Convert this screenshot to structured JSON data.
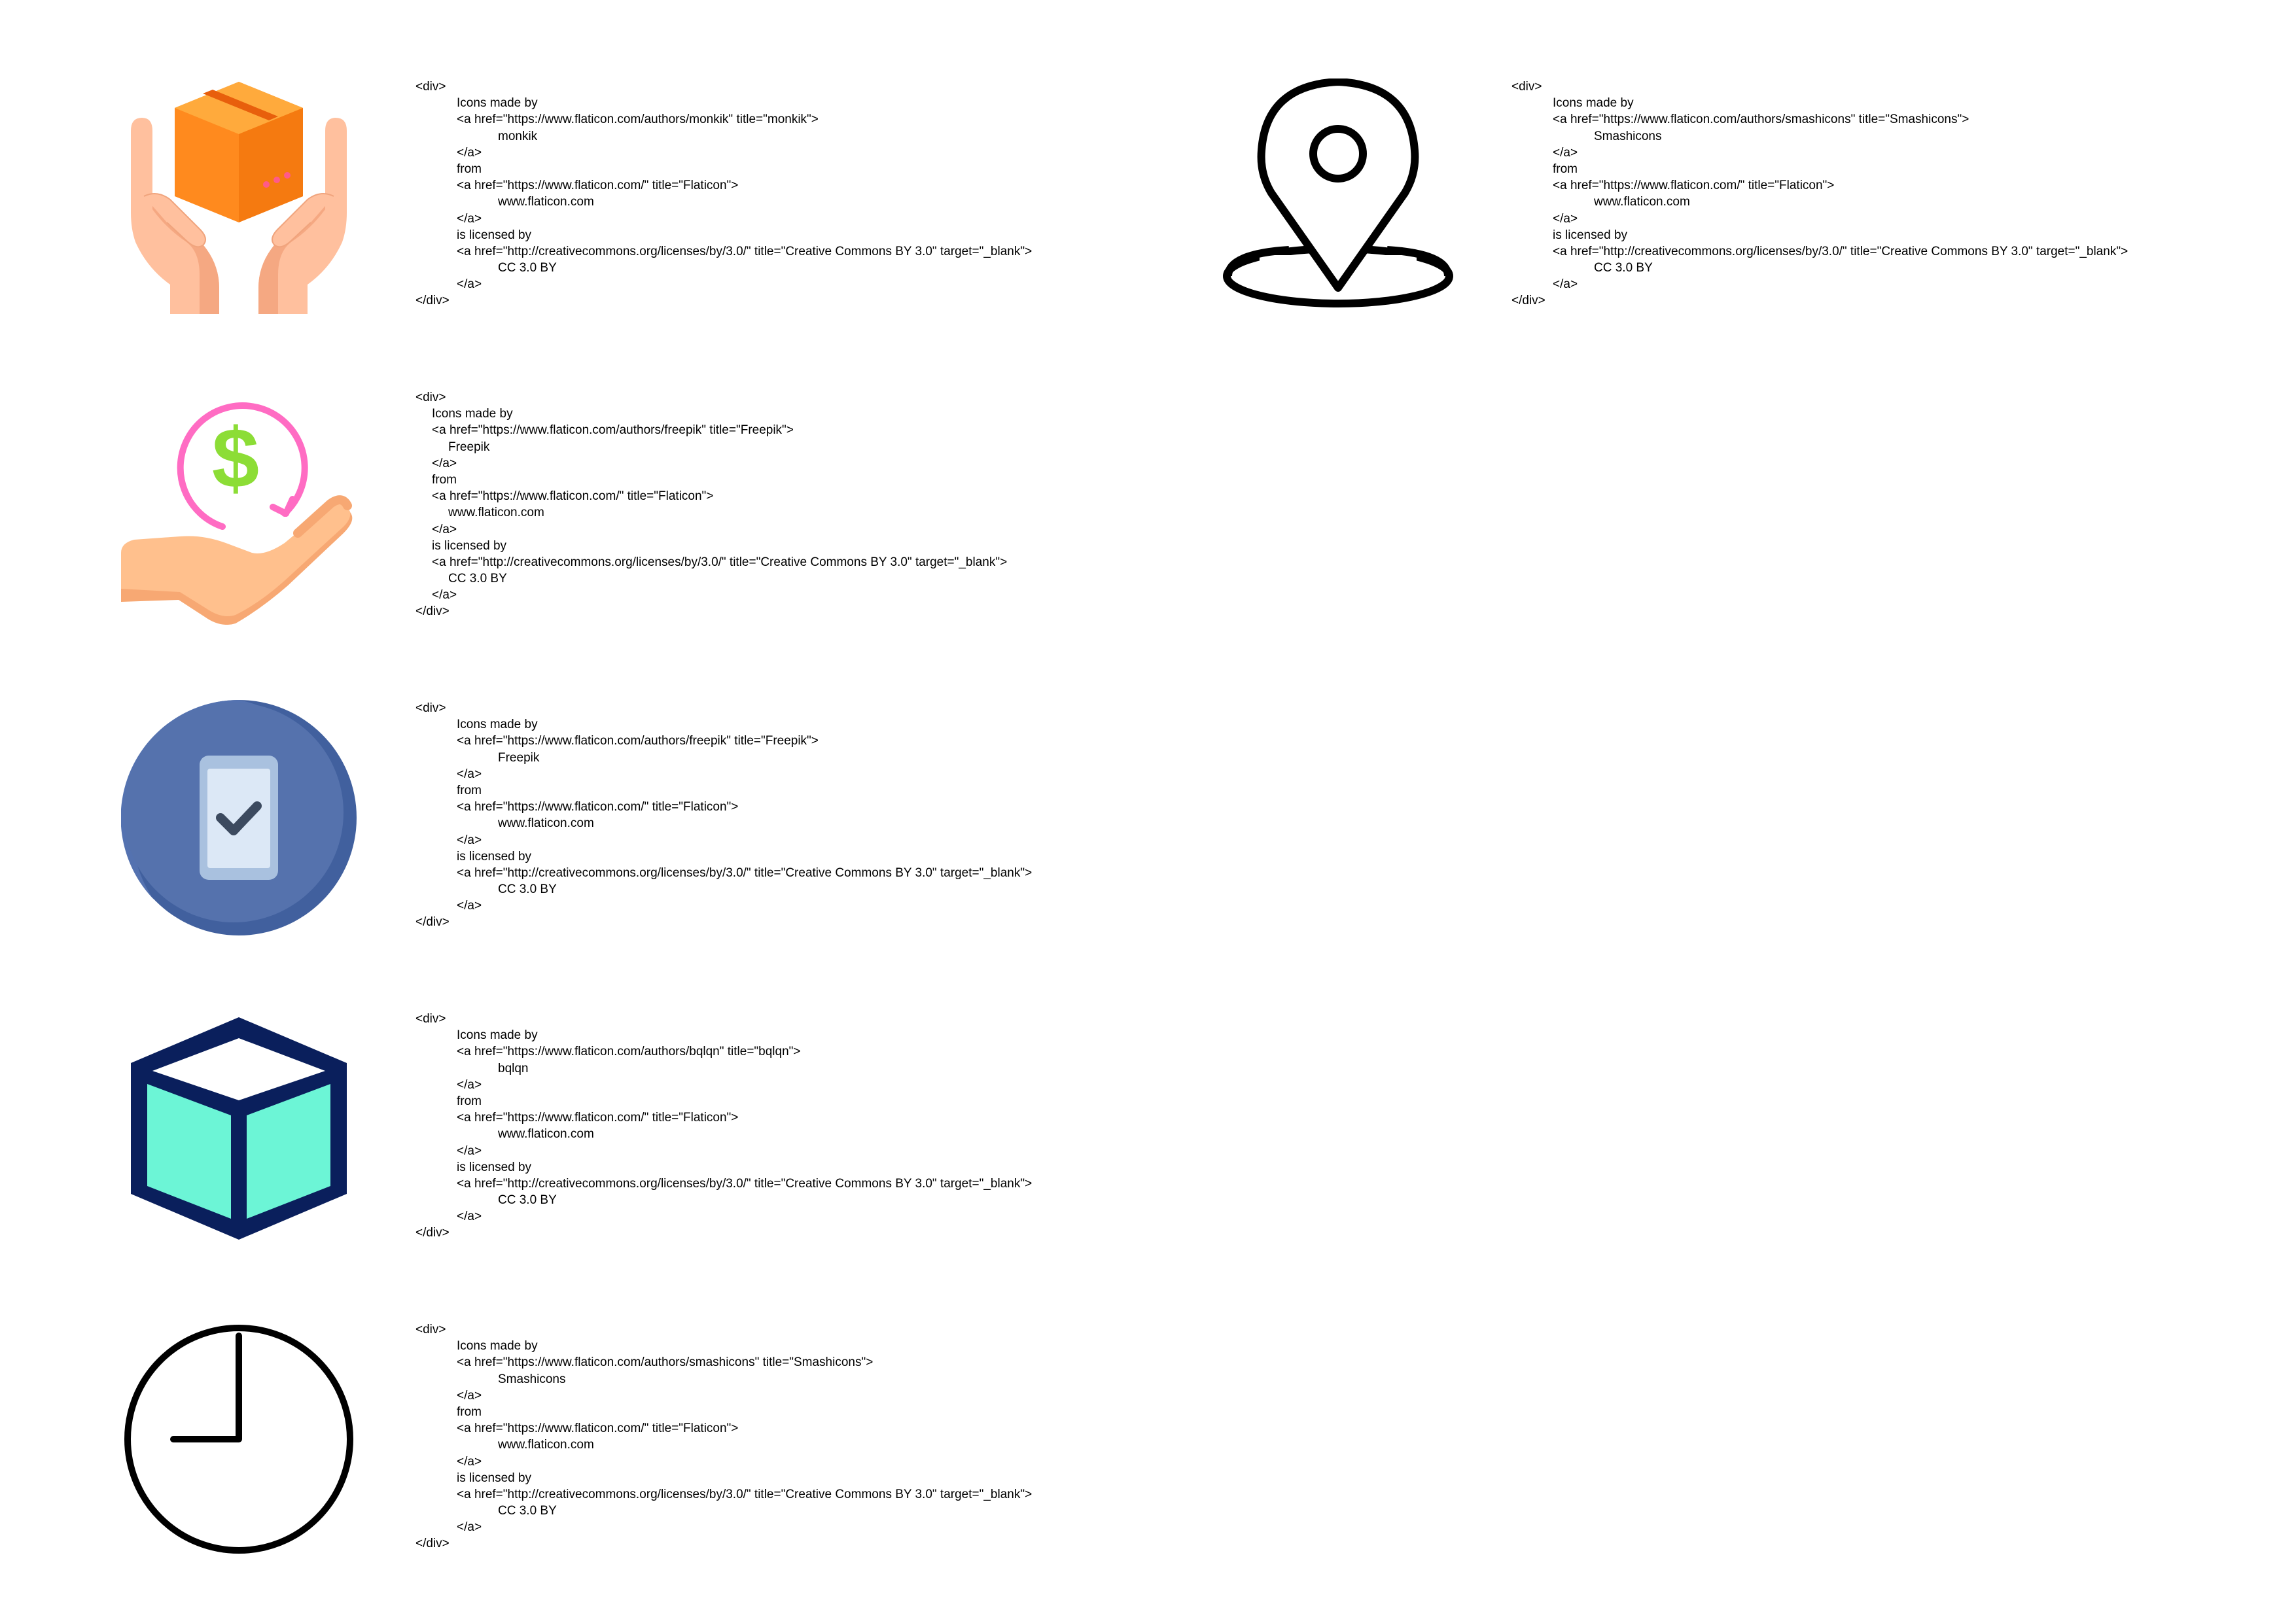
{
  "entries": [
    {
      "icon": "delivery-box-hands-icon",
      "lines": [
        "<div>",
        "Icons made by",
        "<a href=\"https://www.flaticon.com/authors/monkik\" title=\"monkik\">",
        "monkik",
        "</a>",
        "from",
        "<a href=\"https://www.flaticon.com/\" title=\"Flaticon\">",
        "www.flaticon.com",
        "</a>",
        "is licensed by",
        "<a href=\"http://creativecommons.org/licenses/by/3.0/\" title=\"Creative Commons BY 3.0\" target=\"_blank\">",
        "CC 3.0 BY",
        "</a>",
        "</div>"
      ]
    },
    {
      "icon": "location-pin-icon",
      "lines": [
        "<div>",
        "Icons made by",
        "<a href=\"https://www.flaticon.com/authors/smashicons\" title=\"Smashicons\">",
        "Smashicons",
        "</a>",
        "from",
        "<a href=\"https://www.flaticon.com/\" title=\"Flaticon\">",
        "www.flaticon.com",
        "</a>",
        "is licensed by",
        "<a href=\"http://creativecommons.org/licenses/by/3.0/\" title=\"Creative Commons BY 3.0\" target=\"_blank\">",
        "CC 3.0 BY",
        "</a>",
        "</div>"
      ]
    },
    {
      "icon": "refund-dollar-hand-icon",
      "lines": [
        "<div>",
        "Icons made by",
        "<a href=\"https://www.flaticon.com/authors/freepik\" title=\"Freepik\">",
        "Freepik",
        "</a>",
        "from",
        "<a href=\"https://www.flaticon.com/\" title=\"Flaticon\">",
        "www.flaticon.com",
        "</a>",
        "is licensed by",
        "<a href=\"http://creativecommons.org/licenses/by/3.0/\" title=\"Creative Commons BY 3.0\" target=\"_blank\">",
        "CC 3.0 BY",
        "</a>",
        "</div>"
      ]
    },
    {
      "icon": "mobile-check-icon",
      "lines": [
        "<div>",
        "Icons made by",
        "<a href=\"https://www.flaticon.com/authors/freepik\" title=\"Freepik\">",
        "Freepik",
        "</a>",
        "from",
        "<a href=\"https://www.flaticon.com/\" title=\"Flaticon\">",
        "www.flaticon.com",
        "</a>",
        "is licensed by",
        "<a href=\"http://creativecommons.org/licenses/by/3.0/\" title=\"Creative Commons BY 3.0\" target=\"_blank\">",
        "CC 3.0 BY",
        "</a>",
        "</div>"
      ]
    },
    {
      "icon": "cube-icon",
      "lines": [
        "<div>",
        "Icons made by",
        "<a href=\"https://www.flaticon.com/authors/bqlqn\" title=\"bqlqn\">",
        "bqlqn",
        "</a>",
        "from",
        "<a href=\"https://www.flaticon.com/\" title=\"Flaticon\">",
        "www.flaticon.com",
        "</a>",
        "is licensed by",
        "<a href=\"http://creativecommons.org/licenses/by/3.0/\" title=\"Creative Commons BY 3.0\" target=\"_blank\">",
        "CC 3.0 BY",
        "</a>",
        "</div>"
      ]
    },
    {
      "icon": "clock-icon",
      "lines": [
        "<div>",
        "Icons made by",
        "<a href=\"https://www.flaticon.com/authors/smashicons\" title=\"Smashicons\">",
        "Smashicons",
        "</a>",
        "from",
        "<a href=\"https://www.flaticon.com/\" title=\"Flaticon\">",
        "www.flaticon.com",
        "</a>",
        "is licensed by",
        "<a href=\"http://creativecommons.org/licenses/by/3.0/\" title=\"Creative Commons BY 3.0\" target=\"_blank\">",
        "CC 3.0 BY",
        "</a>",
        "</div>"
      ]
    }
  ]
}
